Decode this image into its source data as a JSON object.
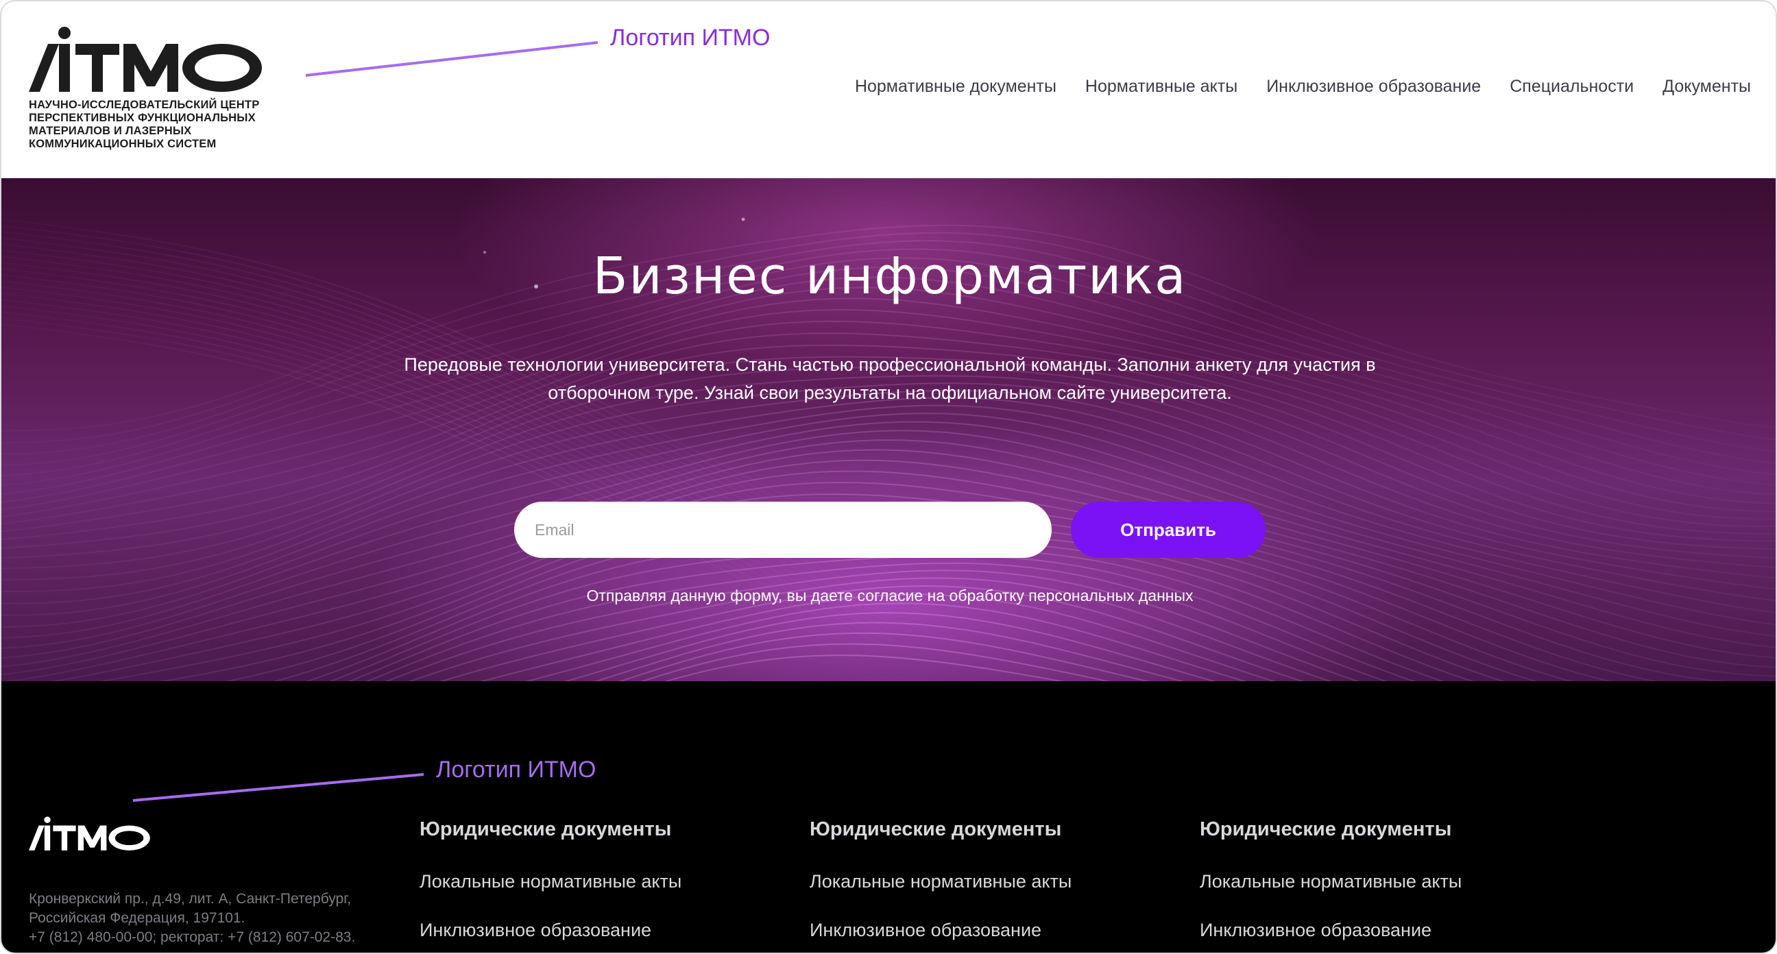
{
  "header": {
    "logo_text": "ИТМО",
    "logo_subtitle": "НАУЧНО-ИССЛЕДОВАТЕЛЬСКИЙ ЦЕНТР ПЕРСПЕКТИВНЫХ ФУНКЦИОНАЛЬНЫХ МАТЕРИАЛОВ И ЛАЗЕРНЫХ КОММУНИКАЦИОННЫХ СИСТЕМ",
    "logo_annotation": "Логотип ИТМО",
    "nav": [
      {
        "label": "Нормативные документы"
      },
      {
        "label": "Нормативные акты"
      },
      {
        "label": "Инклюзивное образование"
      },
      {
        "label": "Специальности"
      },
      {
        "label": "Документы"
      }
    ]
  },
  "hero": {
    "title": "Бизнес информатика",
    "description": "Передовые технологии университета. Стань частью профессиональной команды. Заполни анкету для участия в отборочном туре. Узнай свои результаты на официальном сайте университета.",
    "email_placeholder": "Email",
    "email_value": "",
    "submit_label": "Отправить",
    "consent": "Отправляя данную форму, вы даете согласие на обработку персональных данных"
  },
  "footer": {
    "logo_text": "ИТМО",
    "logo_annotation": "Логотип ИТМО",
    "address": "Кронверкский пр., д.49, лит. А, Санкт-Петербург, Российская Федерация, 197101.",
    "phones": "+7 (812) 480-00-00; ректорат: +7 (812) 607-02-83.",
    "columns": [
      {
        "title": "Юридические документы",
        "links": [
          "Локальные нормативные акты",
          "Инклюзивное образование"
        ]
      },
      {
        "title": "Юридические документы",
        "links": [
          "Локальные нормативные акты",
          "Инклюзивное образование"
        ]
      },
      {
        "title": "Юридические документы",
        "links": [
          "Локальные нормативные акты",
          "Инклюзивное образование"
        ]
      }
    ]
  },
  "colors": {
    "accent": "#7a12f5",
    "annotation": "#8a2be2",
    "footer_bg": "#000000"
  }
}
